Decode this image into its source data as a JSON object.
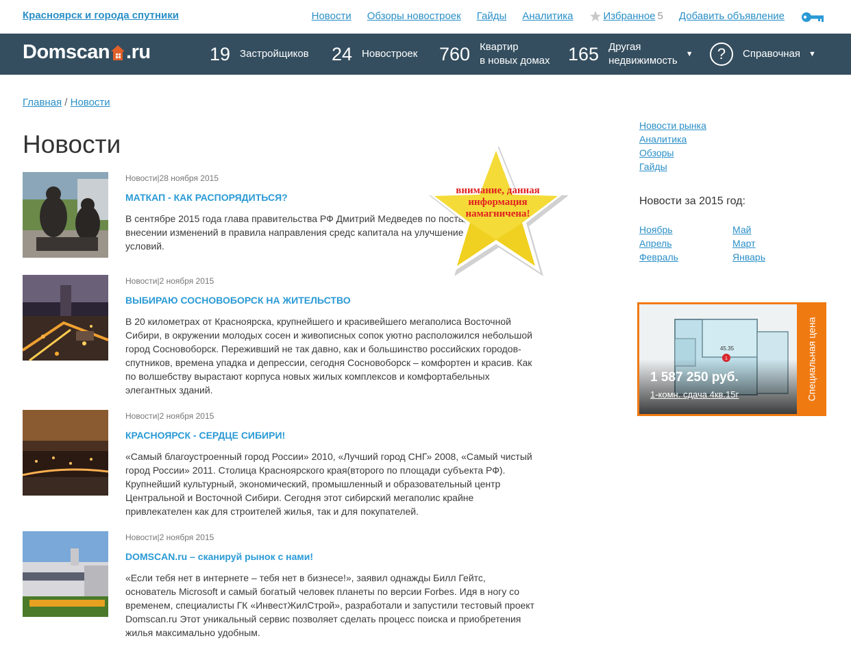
{
  "topbar": {
    "city_link": "Красноярск и города спутники",
    "nav": [
      "Новости",
      "Обзоры новостроек",
      "Гайды",
      "Аналитика"
    ],
    "favorites_label": "Избранное",
    "favorites_count": "5",
    "add_listing": "Добавить объявление"
  },
  "header": {
    "logo_left": "Domscan",
    "logo_right": ".ru",
    "stats": [
      {
        "num": "19",
        "label": "Застройщиков"
      },
      {
        "num": "24",
        "label": "Новостроек"
      },
      {
        "num": "760",
        "label_line1": "Квартир",
        "label_line2": "в новых домах"
      },
      {
        "num": "165",
        "label_line1": "Другая",
        "label_line2": "недвижимость"
      }
    ],
    "help_label": "Справочная"
  },
  "breadcrumb": {
    "home": "Главная",
    "sep": " / ",
    "current": "Новости"
  },
  "page_title": "Новости",
  "news": [
    {
      "category": "Новости",
      "date": "28 ноября 2015",
      "title": "МАТКАП - как распорядиться?",
      "text": "В сентябре 2015 года глава правительства РФ Дмитрий Медведев по постановление о внесении изменений в правила направления средс капитала на улучшение жилищных условий."
    },
    {
      "category": "Новости",
      "date": "2 ноября 2015",
      "title": "Выбираю Сосновоборск на жительство",
      "text": "В 20 километрах от Красноярска, крупнейшего и красивейшего мегаполиса Восточной Сибири, в окружении молодых сосен и живописных сопок уютно расположился небольшой город Сосновоборск. Переживший не так давно, как и большинство российских городов-спутников, времена упадка и депрессии, сегодня Сосновоборск – комфортен и красив. Как по волшебству вырастают корпуса новых жилых комплексов и комфортабельных элегантных зданий."
    },
    {
      "category": "Новости",
      "date": "2 ноября 2015",
      "title": "Красноярск - сердце Сибири!",
      "text": "«Самый благоустроенный город России» 2010, «Лучший город СНГ» 2008, «Самый чистый город России» 2011. Столица Красноярского края(второго по площади субъекта РФ). Крупнейший культурный, экономический, промышленный и образовательный центр Центральной и Восточной Сибири. Сегодня этот сибирский мегаполис крайне привлекателен как для строителей жилья, так и для покупателей."
    },
    {
      "category": "Новости",
      "date": "2 ноября 2015",
      "title": "DOMSCAN.ru – сканируй рынок с нами!",
      "text": "«Если тебя нет в интернете – тебя нет в бизнесе!», заявил однажды Билл Гейтс, основатель Microsoft и самый богатый человек планеты по версии Forbes. Идя в ногу со временем, специалисты ГК «ИнвестЖилСтрой», разработали и запустили тестовый проект Domscan.ru Этот уникальный сервис позволяет сделать процесс поиска и приобретения жилья максимально удобным."
    }
  ],
  "sticker_text": "внимание, данная информация намагничена!",
  "sidebar": {
    "links": [
      "Новости рынка",
      "Аналитика",
      "Обзоры",
      "Гайды"
    ],
    "year_heading": "Новости за 2015 год:",
    "months": [
      "Ноябрь",
      "Май",
      "Апрель",
      "Март",
      "Февраль",
      "Январь"
    ]
  },
  "promo": {
    "price": "1 587 250 руб.",
    "desc": "1-комн. сдача 4кв.15г",
    "side_label": "Специальная цена",
    "plan_area": "45.35",
    "plan_marker": "1"
  },
  "colors": {
    "header_bg": "#344e5f",
    "link": "#2a8fc7",
    "title_link": "#2a9ad5",
    "promo": "#f07a12",
    "sticker": "#f0d020"
  }
}
